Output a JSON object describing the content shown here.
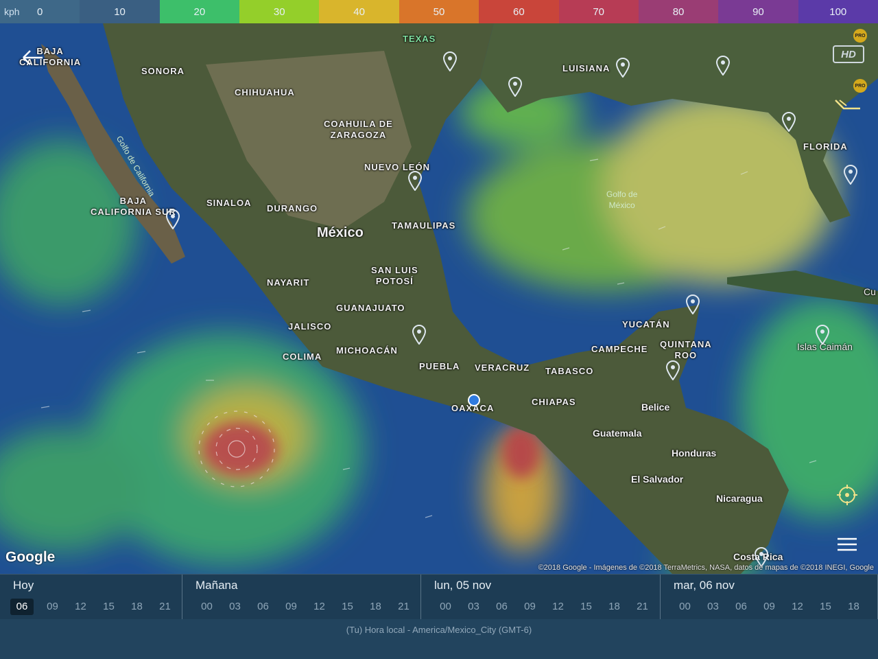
{
  "legend": {
    "unit": "kph",
    "segments": [
      {
        "label": "0",
        "color": "#3e6888"
      },
      {
        "label": "10",
        "color": "#3a5f82"
      },
      {
        "label": "20",
        "color": "#3dbf6a"
      },
      {
        "label": "30",
        "color": "#94cf2a"
      },
      {
        "label": "40",
        "color": "#d9b52c"
      },
      {
        "label": "50",
        "color": "#d9752a"
      },
      {
        "label": "60",
        "color": "#c9453a"
      },
      {
        "label": "70",
        "color": "#b73c55"
      },
      {
        "label": "80",
        "color": "#9a3d74"
      },
      {
        "label": "90",
        "color": "#7a3a94"
      },
      {
        "label": "100",
        "color": "#5b3aa8"
      }
    ]
  },
  "map": {
    "labels": {
      "baja_california_n": "BAJA\nCALIFORNIA",
      "sonora": "SONORA",
      "chihuahua": "CHIHUAHUA",
      "texas": "TEXAS",
      "luisiana": "LUISIANA",
      "florida": "FLORIDA",
      "coahuila": "COAHUILA DE\nZARAGOZA",
      "nuevo_leon": "NUEVO LEÓN",
      "golfo_california": "Golfo de California",
      "baja_california_s": "BAJA\nCALIFORNIA SUR",
      "sinaloa": "SINALOA",
      "durango": "DURANGO",
      "mexico": "México",
      "tamaulipas": "TAMAULIPAS",
      "golfo_mexico": "Golfo de\nMéxico",
      "san_luis": "SAN LUIS\nPOTOSÍ",
      "nayarit": "NAYARIT",
      "guanajuato": "GUANAJUATO",
      "jalisco": "JALISCO",
      "yucatan": "YUCATÁN",
      "quintana_roo": "QUINTANA\nROO",
      "campeche": "CAMPECHE",
      "colima": "COLIMA",
      "michoacan": "MICHOACÁN",
      "puebla": "PUEBLA",
      "veracruz": "VERACRUZ",
      "tabasco": "TABASCO",
      "islas_caiman": "Islas Caimán",
      "cuba": "Cu",
      "oaxaca": "OAXACA",
      "chiapas": "CHIAPAS",
      "belice": "Belice",
      "guatemala": "Guatemala",
      "honduras": "Honduras",
      "el_salvador": "El Salvador",
      "nicaragua": "Nicaragua",
      "costa_rica": "Costa Rica"
    },
    "google_logo": "Google",
    "attribution": "©2018 Google - Imágenes de ©2018 TerraMetrics, NASA, datos de mapas de ©2018 INEGI, Google",
    "pro_badge": "PRO",
    "hd_label": "HD"
  },
  "timeline": {
    "days": [
      {
        "label": "Hoy",
        "hours": [
          "06",
          "09",
          "12",
          "15",
          "18",
          "21"
        ],
        "selected": "06"
      },
      {
        "label": "Mañana",
        "hours": [
          "00",
          "03",
          "06",
          "09",
          "12",
          "15",
          "18",
          "21"
        ]
      },
      {
        "label": "lun, 05 nov",
        "hours": [
          "00",
          "03",
          "06",
          "09",
          "12",
          "15",
          "18",
          "21"
        ]
      },
      {
        "label": "mar, 06 nov",
        "hours": [
          "00",
          "03",
          "06",
          "09",
          "12",
          "15",
          "18"
        ]
      }
    ]
  },
  "footer": {
    "timezone": "(Tu) Hora local - America/Mexico_City (GMT-6)"
  }
}
